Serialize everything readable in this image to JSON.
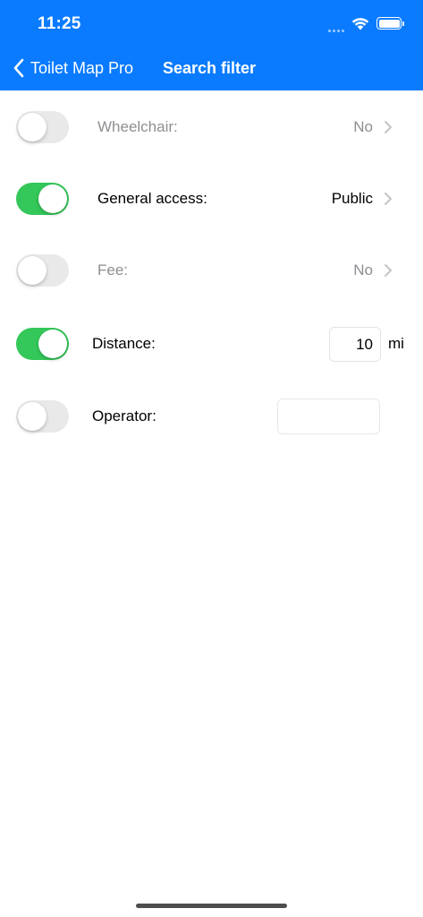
{
  "status_bar": {
    "time": "11:25",
    "icons": [
      "cellular-signal-icon",
      "wifi-icon",
      "battery-icon"
    ],
    "battery_level": 1.0
  },
  "nav": {
    "back_label": "Toilet Map Pro",
    "title": "Search filter",
    "back_icon": "chevron-left-icon"
  },
  "colors": {
    "accent": "#0a7bff",
    "toggle_on": "#34c759",
    "toggle_off": "#e9e9ea",
    "disabled_text": "#8e8e93"
  },
  "filters": {
    "wheelchair": {
      "label": "Wheelchair:",
      "value": "No",
      "enabled": false
    },
    "general_access": {
      "label": "General access:",
      "value": "Public",
      "enabled": true
    },
    "fee": {
      "label": "Fee:",
      "value": "No",
      "enabled": false
    },
    "distance": {
      "label": "Distance:",
      "value": "10",
      "unit": "mi",
      "enabled": true
    },
    "operator": {
      "label": "Operator:",
      "value": "",
      "enabled": false
    }
  }
}
